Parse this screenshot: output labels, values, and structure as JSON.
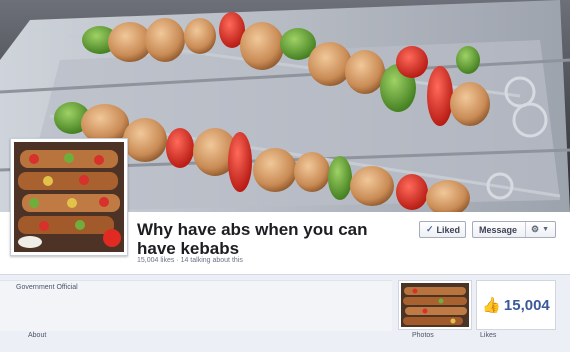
{
  "page": {
    "title": "Why have abs when you can have kebabs",
    "stats": "15,004 likes · 14 talking about this",
    "category": "Government Official"
  },
  "actions": {
    "liked_label": "Liked",
    "message_label": "Message"
  },
  "tabs": {
    "about": "About",
    "photos": "Photos",
    "likes": "Likes",
    "likes_count": "15,004"
  },
  "icons": {
    "check": "check-icon",
    "gear": "gear-icon",
    "caret": "chevron-down-icon",
    "like": "thumbs-up-icon"
  },
  "colors": {
    "brand_blue": "#3b5998",
    "band_background": "#ffffff",
    "page_background": "#eceff5"
  }
}
